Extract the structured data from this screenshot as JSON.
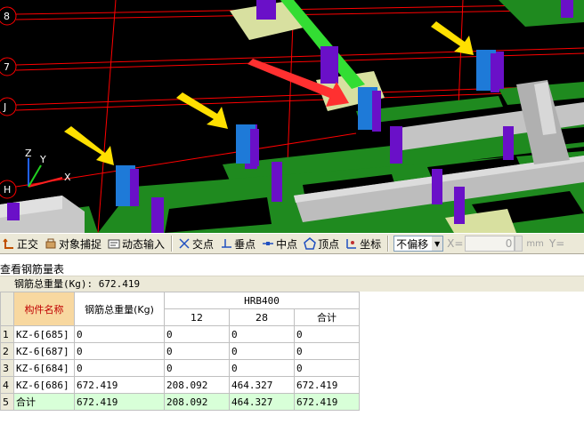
{
  "viewport": {
    "axis_labels": [
      "8",
      "7",
      "J",
      "H"
    ],
    "axes": {
      "x": "X",
      "y": "Y",
      "z": "Z"
    }
  },
  "toolbar": {
    "items": [
      {
        "label": "正交",
        "icon": "ortho-icon"
      },
      {
        "label": "对象捕捉",
        "icon": "snap-icon"
      },
      {
        "label": "动态输入",
        "icon": "dynamic-input-icon"
      },
      {
        "label": "交点",
        "icon": "intersection-icon"
      },
      {
        "label": "垂点",
        "icon": "perpendicular-icon"
      },
      {
        "label": "中点",
        "icon": "midpoint-icon"
      },
      {
        "label": "顶点",
        "icon": "vertex-icon"
      },
      {
        "label": "坐标",
        "icon": "coordinate-icon"
      }
    ],
    "offset_select": "不偏移",
    "x_label": "X=",
    "x_value": "0",
    "unit": "mm",
    "y_label": "Y="
  },
  "panel": {
    "title": "查看钢筋量表",
    "total_line": "钢筋总重量(Kg): 672.419"
  },
  "table": {
    "headers": {
      "name": "构件名称",
      "total": "钢筋总重量(Kg)",
      "group": "HRB400",
      "d12": "12",
      "d28": "28",
      "sum": "合计"
    },
    "rows": [
      {
        "n": "1",
        "name": "KZ-6[685]",
        "total": "0",
        "d12": "0",
        "d28": "0",
        "sum": "0"
      },
      {
        "n": "2",
        "name": "KZ-6[687]",
        "total": "0",
        "d12": "0",
        "d28": "0",
        "sum": "0"
      },
      {
        "n": "3",
        "name": "KZ-6[684]",
        "total": "0",
        "d12": "0",
        "d28": "0",
        "sum": "0"
      },
      {
        "n": "4",
        "name": "KZ-6[686]",
        "total": "672.419",
        "d12": "208.092",
        "d28": "464.327",
        "sum": "672.419"
      },
      {
        "n": "5",
        "name": "合计",
        "total": "672.419",
        "d12": "208.092",
        "d28": "464.327",
        "sum": "672.419"
      }
    ]
  },
  "colors": {
    "canvas": "#000000",
    "slab": "#1f8a1f",
    "wall": "#b8b8b8",
    "column": "#6a10c8",
    "column_highlight": "#1e7ad8",
    "arrow_yellow": "#ffe000",
    "arrow_red": "#ff3030",
    "grid_line": "#ff0000"
  }
}
